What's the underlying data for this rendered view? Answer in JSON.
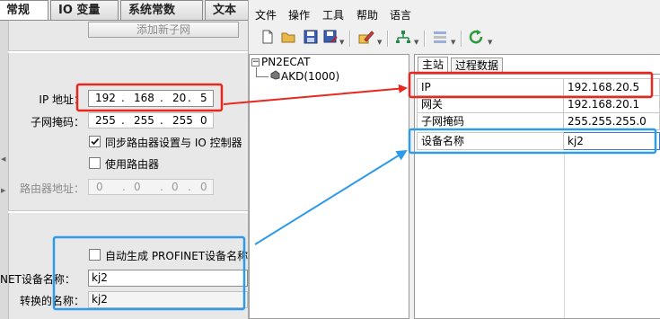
{
  "left_tabs": [
    "常规",
    "IO 变量",
    "系统常数",
    "文本"
  ],
  "add_subnet_button": "添加新子网",
  "ip": {
    "label": "IP 地址：",
    "octets": [
      "192",
      "168",
      "20",
      "5"
    ]
  },
  "subnet_mask": {
    "label": "子网掩码：",
    "octets": [
      "255",
      "255",
      "255",
      "0"
    ]
  },
  "sync_router": {
    "label": "同步路由器设置与 IO 控制器",
    "checked": true
  },
  "use_router": {
    "label": "使用路由器",
    "checked": false
  },
  "router_addr": {
    "label": "路由器地址：",
    "octets": [
      "0",
      "0",
      "0",
      "0"
    ]
  },
  "auto_name": {
    "label": "自动生成 PROFINET设备名称",
    "checked": false
  },
  "device_name_field": {
    "label": "NET设备名称：",
    "value": "kj2"
  },
  "converted_name": {
    "label": "转换的名称：",
    "value": "kj2"
  },
  "menu": [
    "文件",
    "操作",
    "工具",
    "帮助",
    "语言"
  ],
  "tree": {
    "root": "PN2ECAT",
    "child": "AKD(1000)"
  },
  "right_tabs": [
    "主站",
    "过程数据"
  ],
  "grid": [
    {
      "key": "IP",
      "value": "192.168.20.5"
    },
    {
      "key": "网关",
      "value": "192.168.20.1"
    },
    {
      "key": "子网掩码",
      "value": "255.255.255.0"
    },
    {
      "key": "设备名称",
      "value": "kj2"
    }
  ],
  "colors": {
    "highlight_red": "#e8281e",
    "highlight_blue": "#2e9be8",
    "tab_active": "#ffffff"
  },
  "icons": [
    "new-file-icon",
    "open-folder-icon",
    "save-icon",
    "save-as-icon",
    "edit-pencil-icon",
    "network-icon",
    "config-icon",
    "refresh-icon"
  ]
}
